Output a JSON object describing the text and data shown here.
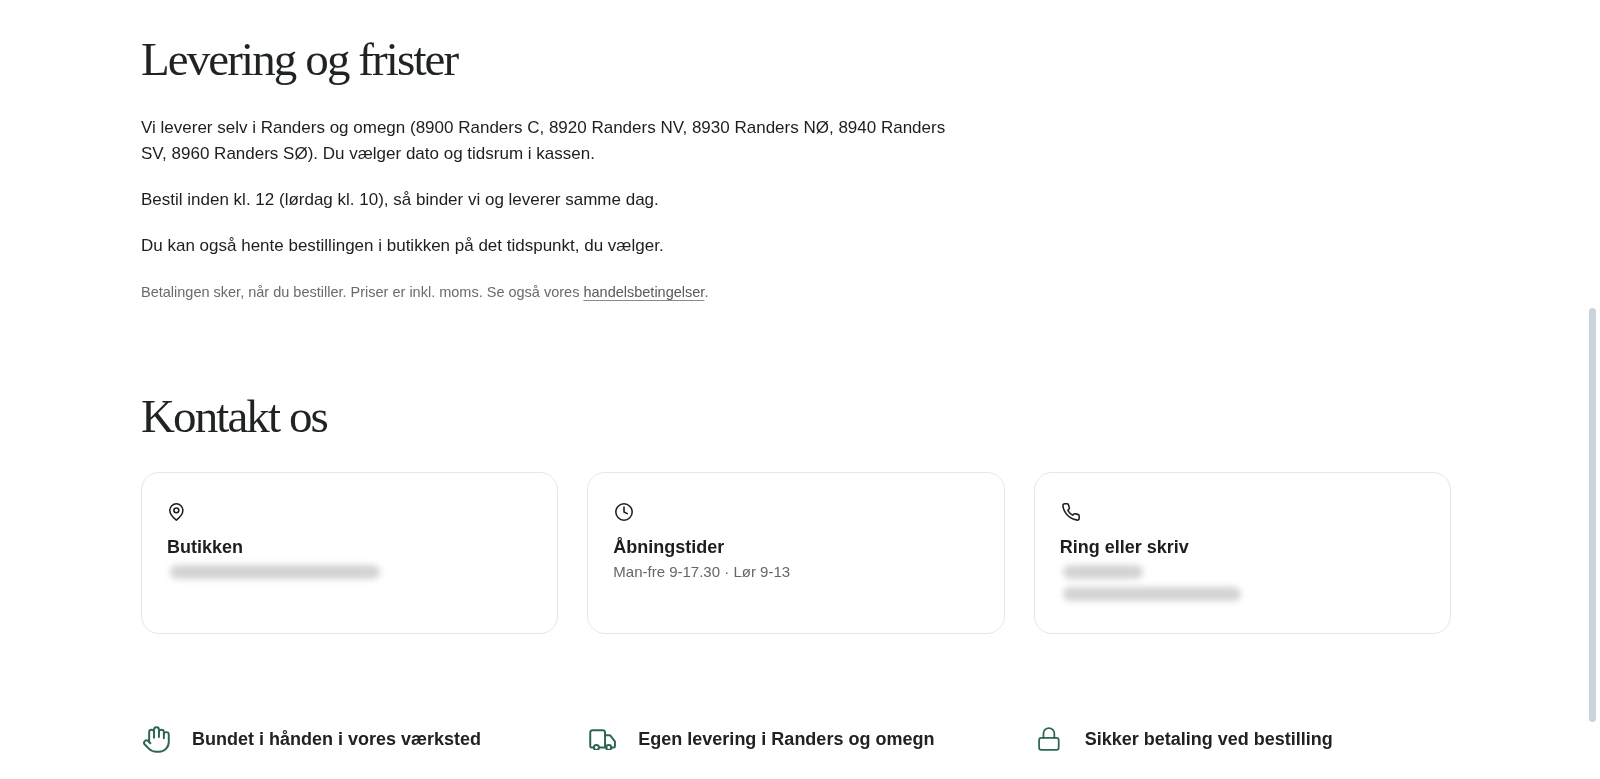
{
  "delivery": {
    "title": "Levering og frister",
    "paragraphs": [
      "Vi leverer selv i Randers og omegn (8900 Randers C, 8920 Randers NV, 8930 Randers NØ, 8940 Randers SV, 8960 Randers SØ). Du vælger dato og tidsrum i kassen.",
      "Bestil inden kl. 12 (lørdag kl. 10), så binder vi og leverer samme dag.",
      "Du kan også hente bestillingen i butikken på det tidspunkt, du vælger."
    ],
    "note": {
      "before": "Betalingen sker, når du bestiller. Priser er inkl. moms. Se også vores ",
      "link": "handelsbetingelser",
      "after": "."
    }
  },
  "contact": {
    "title": "Kontakt os",
    "cards": [
      {
        "title": "Butikken",
        "details": [
          {
            "kind": "blurred"
          }
        ]
      },
      {
        "title": "Åbningstider",
        "details": [
          {
            "kind": "text",
            "text": "Man-fre 9-17.30 · Lør 9-13"
          }
        ]
      },
      {
        "title": "Ring eller skriv",
        "details": [
          {
            "kind": "blurred"
          },
          {
            "kind": "blurred"
          }
        ]
      }
    ]
  },
  "features": [
    {
      "text": "Bundet i hånden i vores værksted"
    },
    {
      "text": "Egen levering i Randers og omegn"
    },
    {
      "text": "Sikker betaling ved bestilling"
    }
  ]
}
